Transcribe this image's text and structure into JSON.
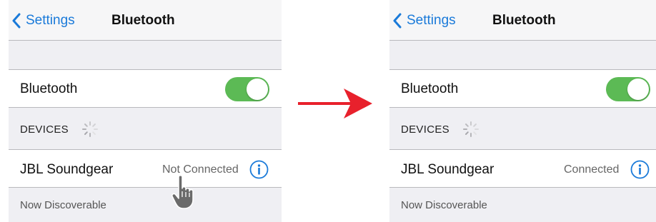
{
  "colors": {
    "accent_blue": "#1a7ad9",
    "toggle_green": "#5cba55",
    "arrow_red": "#e8212c",
    "group_background": "#efeff3",
    "separator": "#b9b9bd"
  },
  "before": {
    "navbar": {
      "back_label": "Settings",
      "title": "Bluetooth",
      "back_icon": "chevron-left-icon"
    },
    "bluetooth_row": {
      "label": "Bluetooth",
      "toggle_on": true
    },
    "devices_header": {
      "label": "DEVICES",
      "spinner_icon": "loading-spinner-icon"
    },
    "device": {
      "name": "JBL Soundgear",
      "status": "Not Connected",
      "info_icon": "info-icon"
    },
    "footer": {
      "text": "Now Discoverable"
    },
    "pointer_icon": "hand-pointer-icon"
  },
  "after": {
    "navbar": {
      "back_label": "Settings",
      "title": "Bluetooth",
      "back_icon": "chevron-left-icon"
    },
    "bluetooth_row": {
      "label": "Bluetooth",
      "toggle_on": true
    },
    "devices_header": {
      "label": "DEVICES",
      "spinner_icon": "loading-spinner-icon"
    },
    "device": {
      "name": "JBL Soundgear",
      "status": "Connected",
      "info_icon": "info-icon"
    },
    "footer": {
      "text": "Now Discoverable"
    }
  },
  "transition_icon": "right-arrow-icon"
}
